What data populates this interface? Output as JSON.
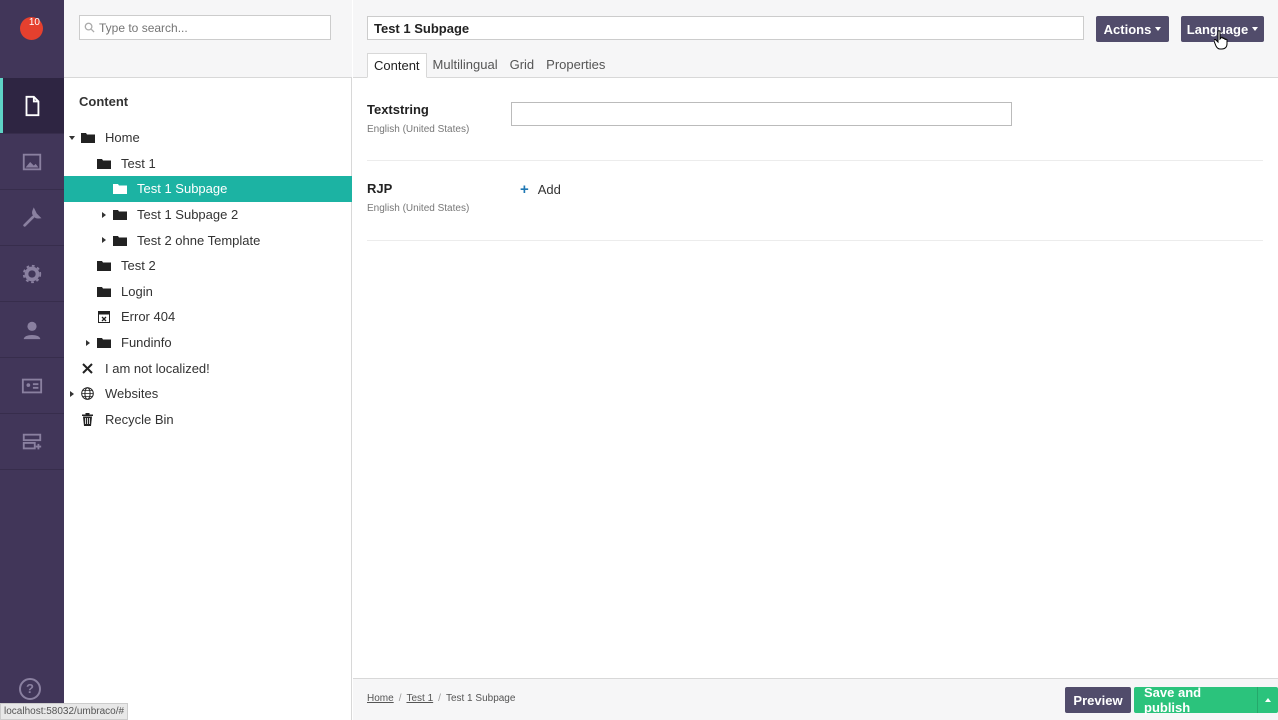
{
  "user": {
    "badge_count": "10"
  },
  "search": {
    "placeholder": "Type to search..."
  },
  "tree": {
    "title": "Content",
    "items": [
      {
        "label": "Home",
        "level": 0,
        "caret": "down",
        "icon": "folder-icon"
      },
      {
        "label": "Test 1",
        "level": 1,
        "caret": "none",
        "icon": "folder-icon"
      },
      {
        "label": "Test 1 Subpage",
        "level": 2,
        "caret": "none",
        "icon": "folder-icon",
        "selected": true
      },
      {
        "label": "Test 1 Subpage 2",
        "level": 2,
        "caret": "right",
        "icon": "folder-icon"
      },
      {
        "label": "Test 2 ohne Template",
        "level": 2,
        "caret": "right",
        "icon": "folder-icon"
      },
      {
        "label": "Test 2",
        "level": 1,
        "caret": "none",
        "icon": "folder-icon"
      },
      {
        "label": "Login",
        "level": 1,
        "caret": "none",
        "icon": "folder-icon"
      },
      {
        "label": "Error 404",
        "level": 1,
        "caret": "none",
        "icon": "error-page-icon"
      },
      {
        "label": "Fundinfo",
        "level": 1,
        "caret": "right",
        "icon": "folder-icon"
      },
      {
        "label": "I am not localized!",
        "level": 0,
        "caret": "none",
        "icon": "close-icon"
      },
      {
        "label": "Websites",
        "level": 0,
        "caret": "right",
        "icon": "globe-icon"
      },
      {
        "label": "Recycle Bin",
        "level": 0,
        "caret": "none",
        "icon": "trash-icon"
      }
    ]
  },
  "editor": {
    "node_name": "Test 1 Subpage",
    "actions_label": "Actions",
    "language_label": "Language",
    "tabs": [
      "Content",
      "Multilingual",
      "Grid",
      "Properties"
    ],
    "properties": [
      {
        "label": "Textstring",
        "description": "English (United States)",
        "value": ""
      },
      {
        "label": "RJP",
        "description": "English (United States)",
        "add_label": "Add"
      }
    ]
  },
  "footer": {
    "breadcrumb": [
      "Home",
      "Test 1",
      "Test 1 Subpage"
    ],
    "preview_label": "Preview",
    "save_publish_label": "Save and publish"
  },
  "status_bar": {
    "url": "localhost:58032/umbraco/#"
  },
  "colors": {
    "rail": "#413659",
    "selected": "#1cb3a3",
    "primary_button": "#514c6b",
    "success_button": "#2bc37c"
  }
}
